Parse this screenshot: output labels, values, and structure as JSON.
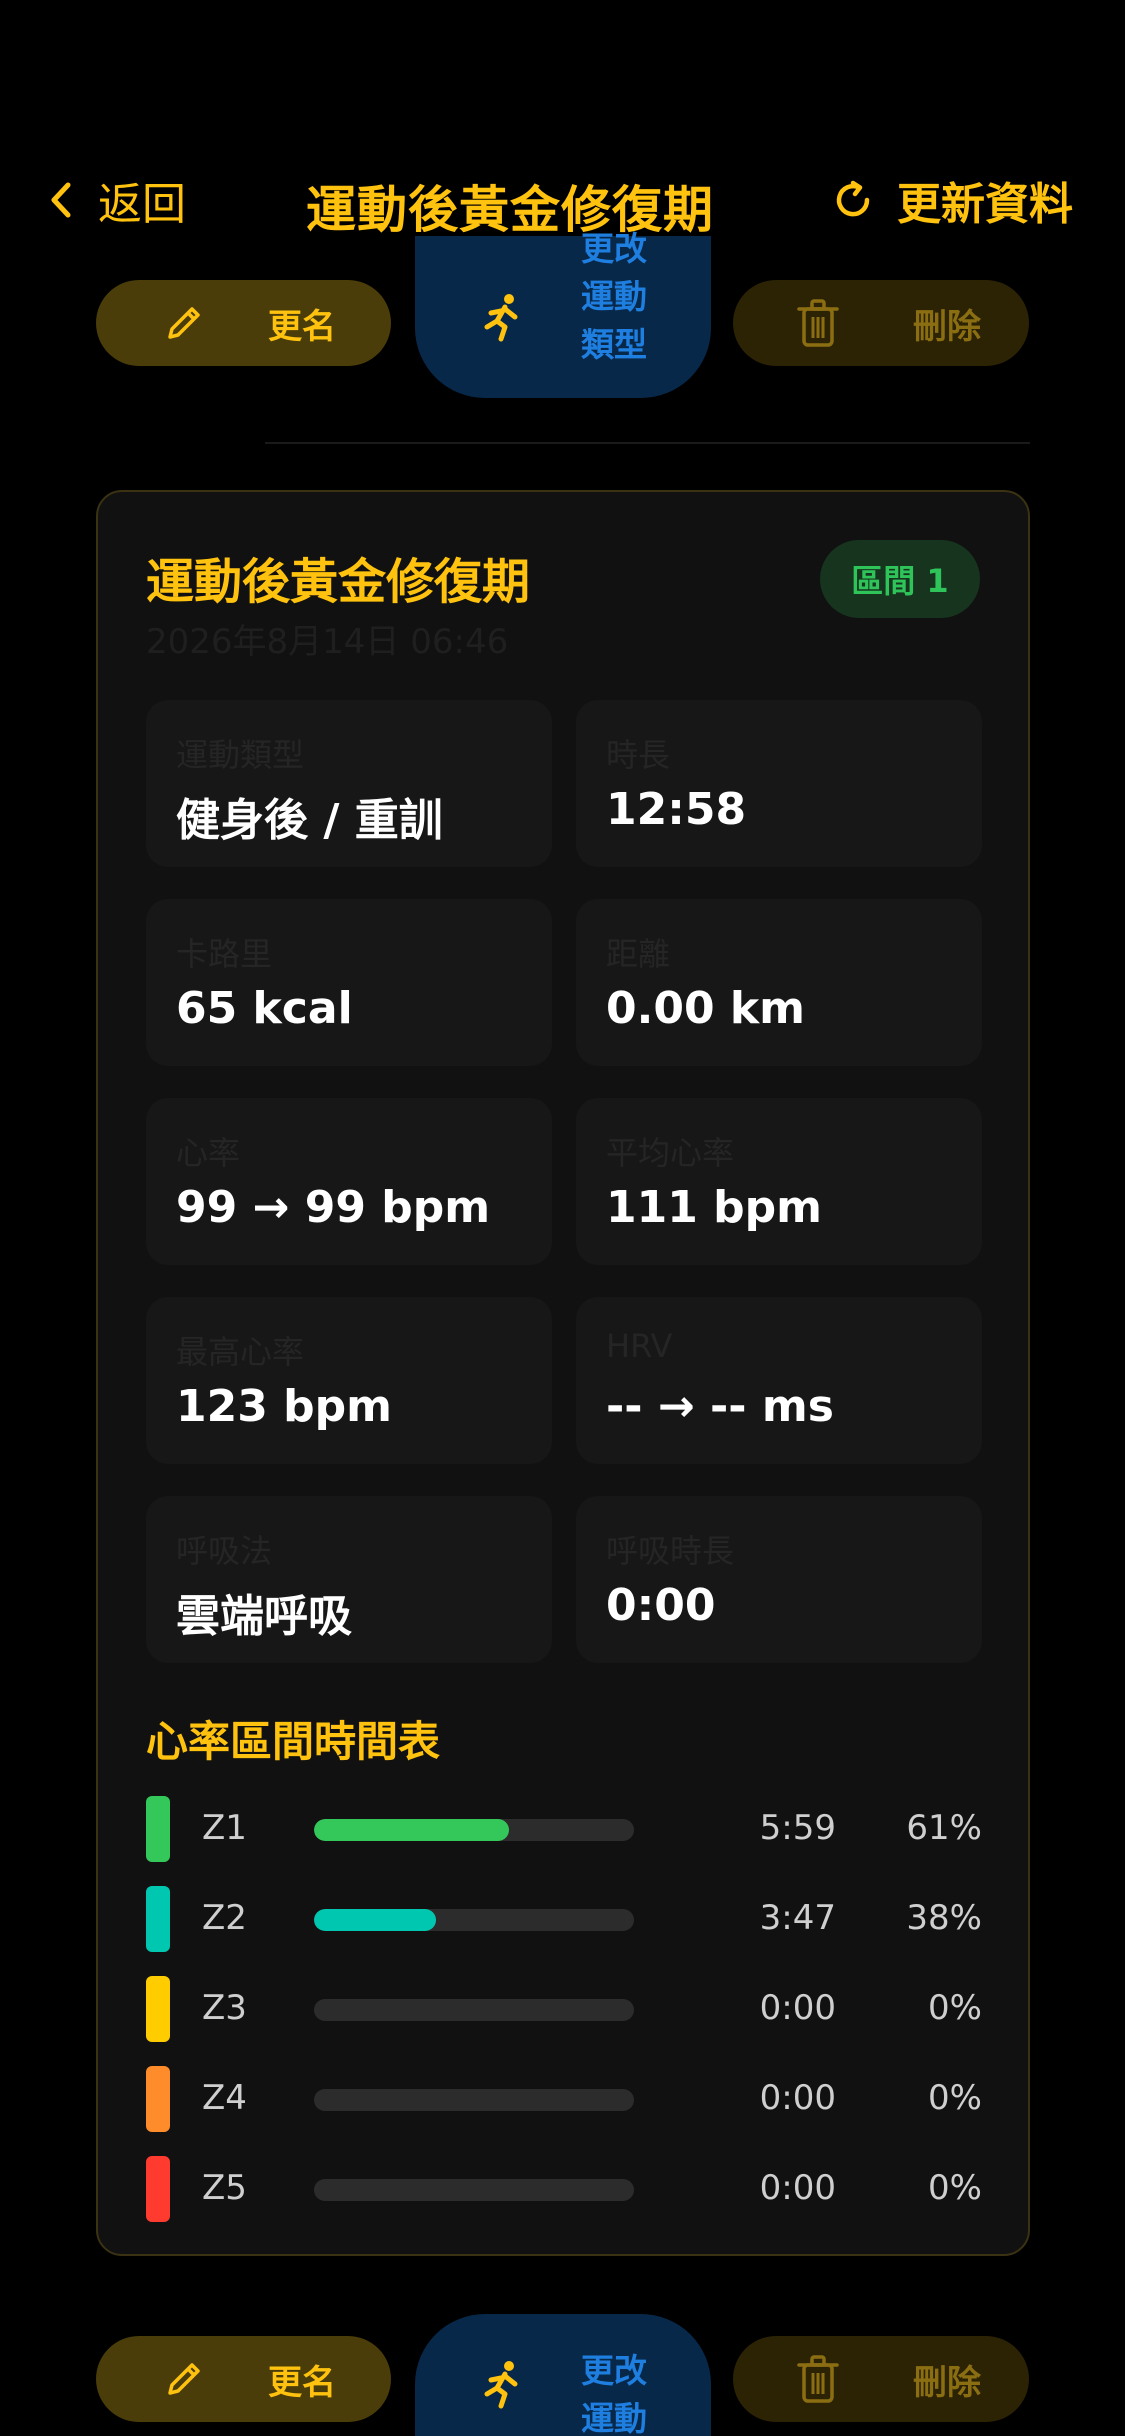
{
  "header": {
    "back_label": "返回",
    "title": "運動後黃金修復期",
    "refresh_label": "更新資料"
  },
  "actions": {
    "rename_label": "更名",
    "change_type_label": "更改運動類型",
    "delete_label": "刪除"
  },
  "card": {
    "title": "運動後黃金修復期",
    "date": "2026年8月14日 06:46",
    "zone_badge": "區間 1",
    "stats": [
      {
        "label": "運動類型",
        "value": "健身後 / 重訓"
      },
      {
        "label": "時長",
        "value": "12:58"
      },
      {
        "label": "卡路里",
        "value": "65 kcal"
      },
      {
        "label": "距離",
        "value": "0.00 km"
      },
      {
        "label": "心率",
        "value": "99 → 99 bpm"
      },
      {
        "label": "平均心率",
        "value": "111 bpm"
      },
      {
        "label": "最高心率",
        "value": "123 bpm"
      },
      {
        "label": "HRV",
        "value": "-- → -- ms"
      },
      {
        "label": "呼吸法",
        "value": "雲端呼吸"
      },
      {
        "label": "呼吸時長",
        "value": "0:00"
      }
    ],
    "zones_title": "心率區間時間表",
    "zones": [
      {
        "name": "Z1",
        "time": "5:59",
        "pct": "61%",
        "fraction": 0.61,
        "color": "#34C759"
      },
      {
        "name": "Z2",
        "time": "3:47",
        "pct": "38%",
        "fraction": 0.38,
        "color": "#00C7B0"
      },
      {
        "name": "Z3",
        "time": "0:00",
        "pct": "0%",
        "fraction": 0.0,
        "color": "#FFCC00"
      },
      {
        "name": "Z4",
        "time": "0:00",
        "pct": "0%",
        "fraction": 0.0,
        "color": "#FF8C2A"
      },
      {
        "name": "Z5",
        "time": "0:00",
        "pct": "0%",
        "fraction": 0.0,
        "color": "#FF3B30"
      }
    ]
  },
  "icons": {
    "back": "chevron-left-icon",
    "refresh": "refresh-icon",
    "rename": "pencil-icon",
    "type": "running-icon",
    "delete": "trash-icon"
  },
  "colors": {
    "accent": "#FFC20E",
    "blue": "#1E7FE0",
    "green": "#2FC45A"
  }
}
